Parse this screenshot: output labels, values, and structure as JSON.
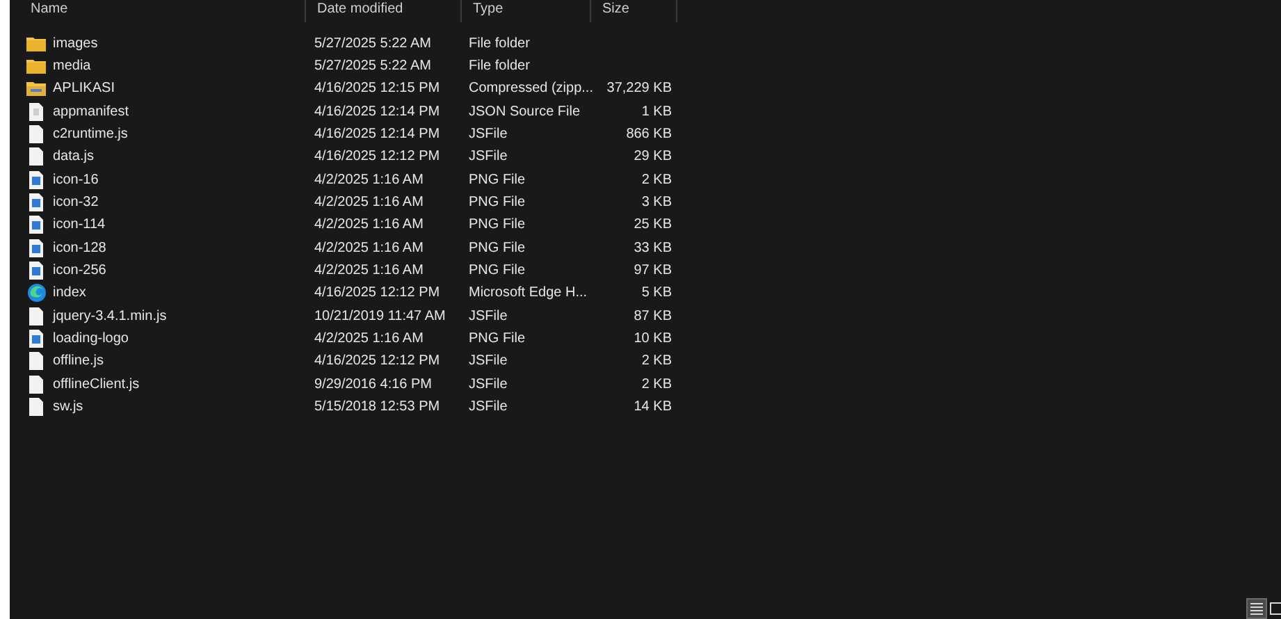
{
  "columns": [
    "Name",
    "Date modified",
    "Type",
    "Size"
  ],
  "rows": [
    {
      "kind": "folder",
      "name": "images",
      "date": "5/27/2025 5:22 AM",
      "type": "File folder"
    },
    {
      "kind": "folder",
      "name": "media",
      "date": "5/27/2025 5:22 AM",
      "type": "File folder"
    },
    {
      "kind": "zip",
      "name": "APLIKASI",
      "date": "4/16/2025 12:15 PM",
      "type": "Compressed (zipp...",
      "size": "37,229 KB"
    },
    {
      "kind": "json",
      "name": "appmanifest",
      "date": "4/16/2025 12:14 PM",
      "type": "JSON Source File",
      "size": "1 KB"
    },
    {
      "kind": "file",
      "name": "c2runtime.js",
      "date": "4/16/2025 12:14 PM",
      "type": "JSFile",
      "size": "866 KB"
    },
    {
      "kind": "file",
      "name": "data.js",
      "date": "4/16/2025 12:12 PM",
      "type": "JSFile",
      "size": "29 KB"
    },
    {
      "kind": "image",
      "name": "icon-16",
      "date": "4/2/2025 1:16 AM",
      "type": "PNG File",
      "size": "2 KB"
    },
    {
      "kind": "image",
      "name": "icon-32",
      "date": "4/2/2025 1:16 AM",
      "type": "PNG File",
      "size": "3 KB"
    },
    {
      "kind": "image",
      "name": "icon-114",
      "date": "4/2/2025 1:16 AM",
      "type": "PNG File",
      "size": "25 KB"
    },
    {
      "kind": "image",
      "name": "icon-128",
      "date": "4/2/2025 1:16 AM",
      "type": "PNG File",
      "size": "33 KB"
    },
    {
      "kind": "image",
      "name": "icon-256",
      "date": "4/2/2025 1:16 AM",
      "type": "PNG File",
      "size": "97 KB"
    },
    {
      "kind": "edge",
      "name": "index",
      "date": "4/16/2025 12:12 PM",
      "type": "Microsoft Edge H...",
      "size": "5 KB"
    },
    {
      "kind": "file",
      "name": "jquery-3.4.1.min.js",
      "date": "10/21/2019 11:47 AM",
      "type": "JSFile",
      "size": "87 KB"
    },
    {
      "kind": "image",
      "name": "loading-logo",
      "date": "4/2/2025 1:16 AM",
      "type": "PNG File",
      "size": "10 KB"
    },
    {
      "kind": "file",
      "name": "offline.js",
      "date": "4/16/2025 12:12 PM",
      "type": "JSFile",
      "size": "2 KB"
    },
    {
      "kind": "file",
      "name": "offlineClient.js",
      "date": "9/29/2016 4:16 PM",
      "type": "JSFile",
      "size": "2 KB"
    },
    {
      "kind": "file",
      "name": "sw.js",
      "date": "5/15/2018 12:53 PM",
      "type": "JSFile",
      "size": "14 KB"
    }
  ],
  "view_buttons": [
    {
      "kind": "details",
      "selected": true
    },
    {
      "kind": "tiles",
      "selected": false
    }
  ]
}
